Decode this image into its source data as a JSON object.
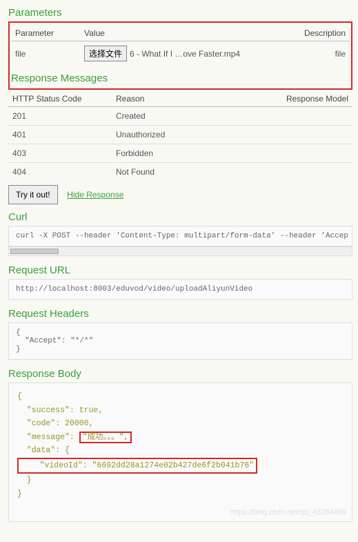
{
  "parameters": {
    "heading": "Parameters",
    "cols": {
      "param": "Parameter",
      "value": "Value",
      "desc": "Description"
    },
    "row": {
      "name": "file",
      "button": "选择文件",
      "filename": "6 - What If I …ove Faster.mp4",
      "type": "file"
    }
  },
  "responseMessages": {
    "heading": "Response Messages",
    "cols": {
      "code": "HTTP Status Code",
      "reason": "Reason",
      "model": "Response Model"
    },
    "rows": [
      {
        "code": "201",
        "reason": "Created"
      },
      {
        "code": "401",
        "reason": "Unauthorized"
      },
      {
        "code": "403",
        "reason": "Forbidden"
      },
      {
        "code": "404",
        "reason": "Not Found"
      }
    ]
  },
  "actions": {
    "try": "Try it out!",
    "hide": "Hide Response"
  },
  "curl": {
    "heading": "Curl",
    "text": "curl -X POST --header 'Content-Type: multipart/form-data' --header 'Accep"
  },
  "requestUrl": {
    "heading": "Request URL",
    "text": "http://localhost:8003/eduvod/video/uploadAliyunVideo"
  },
  "requestHeaders": {
    "heading": "Request Headers",
    "text": "{\n  \"Accept\": \"*/*\"\n}"
  },
  "responseBody": {
    "heading": "Response Body",
    "open": "{",
    "l1": "  \"success\": true,",
    "l2": "  \"code\": 20000,",
    "l3a": "  \"message\": ",
    "l3b": "\"成功。。。\",",
    "l4": "  \"data\": {",
    "l5": "    \"videoId\": \"6692dd28a1274e02b427de6f2b041b76\"",
    "l6": "  }",
    "close": "}"
  },
  "watermark": "https://blog.csdn.net/qq_43284469"
}
